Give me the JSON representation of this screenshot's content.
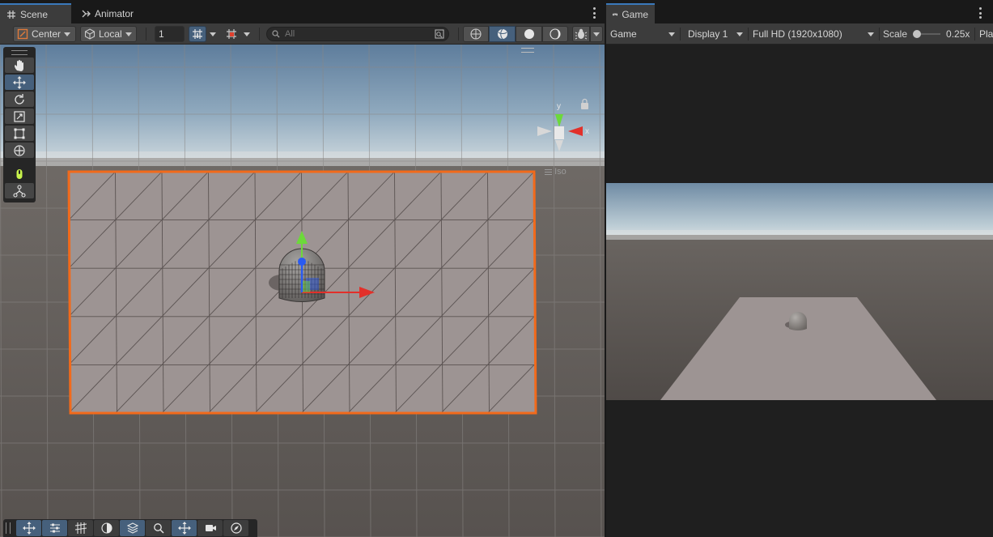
{
  "scene_window": {
    "tabs": [
      {
        "label": "Scene",
        "icon": "grid-hash-icon",
        "active": true
      },
      {
        "label": "Animator",
        "icon": "animator-icon",
        "active": false
      }
    ],
    "toolbar": {
      "pivot_label": "Center",
      "space_label": "Local",
      "grid_snap_value": "1",
      "search_placeholder": "All"
    },
    "gizmo": {
      "axis_x": "x",
      "axis_y": "y",
      "projection_label": "Iso"
    },
    "tools": [
      "hand-tool-icon",
      "move-tool-icon",
      "rotate-tool-icon",
      "scale-tool-icon",
      "rect-tool-icon",
      "transform-tool-icon",
      "custom-tool-icon",
      "editor-tool-icon"
    ],
    "colors": {
      "selection_outline": "#f26a1b",
      "accent": "#3a79bb",
      "axis_x": "#e2302a",
      "axis_y": "#6cd93a",
      "axis_z": "#2a5bf2"
    }
  },
  "game_window": {
    "tab_label": "Game",
    "toolbar": {
      "view_mode": "Game",
      "display": "Display 1",
      "resolution": "Full HD (1920x1080)",
      "scale_label": "Scale",
      "scale_value": "0.25x",
      "play_label": "Pla"
    }
  }
}
